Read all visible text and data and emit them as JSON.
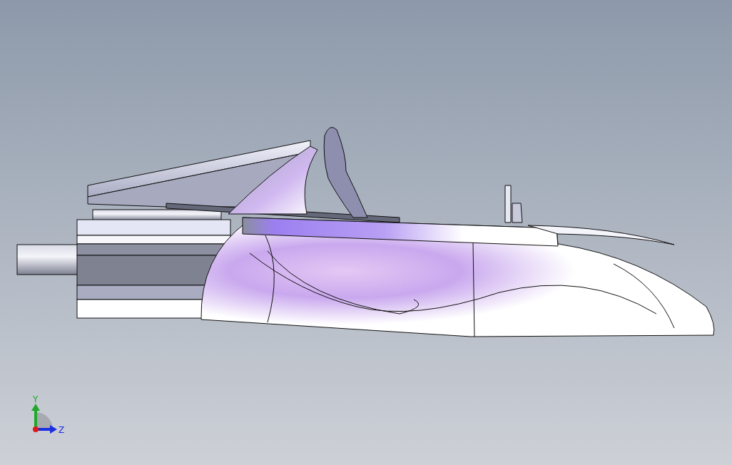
{
  "viewport": {
    "triad": {
      "y_label": "Y",
      "z_label": "Z"
    }
  }
}
